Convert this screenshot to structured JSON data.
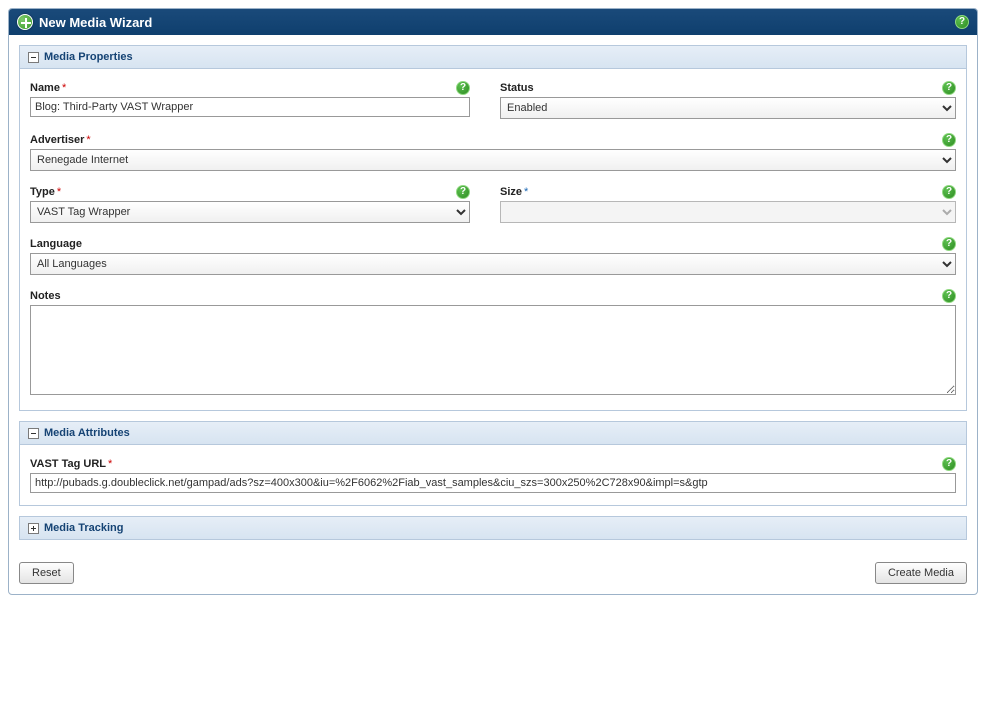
{
  "header": {
    "title": "New Media Wizard"
  },
  "sections": {
    "media_properties": {
      "title": "Media Properties"
    },
    "media_attributes": {
      "title": "Media Attributes"
    },
    "media_tracking": {
      "title": "Media Tracking"
    }
  },
  "fields": {
    "name": {
      "label": "Name",
      "value": "Blog: Third-Party VAST Wrapper",
      "required": true
    },
    "status": {
      "label": "Status",
      "value": "Enabled"
    },
    "advertiser": {
      "label": "Advertiser",
      "value": "Renegade Internet",
      "required": true
    },
    "type": {
      "label": "Type",
      "value": "VAST Tag Wrapper",
      "required": true
    },
    "size": {
      "label": "Size",
      "value": "",
      "required": true
    },
    "language": {
      "label": "Language",
      "value": "All Languages"
    },
    "notes": {
      "label": "Notes",
      "value": ""
    },
    "vast_url": {
      "label": "VAST Tag URL",
      "required": true,
      "value": "http://pubads.g.doubleclick.net/gampad/ads?sz=400x300&iu=%2F6062%2Fiab_vast_samples&ciu_szs=300x250%2C728x90&impl=s&gtp"
    }
  },
  "buttons": {
    "reset": "Reset",
    "create": "Create Media"
  }
}
